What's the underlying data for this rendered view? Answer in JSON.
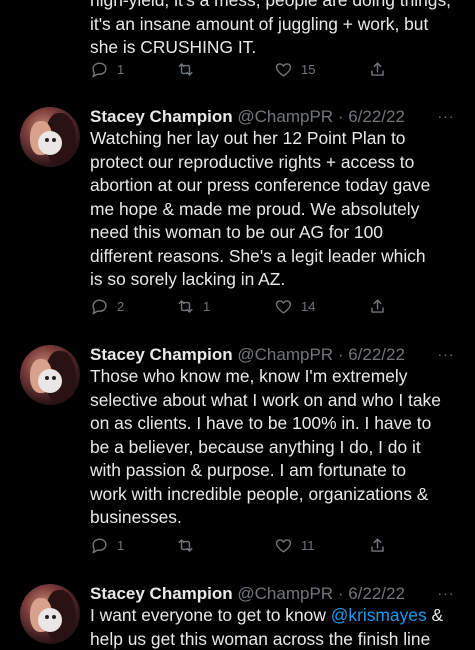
{
  "tweets": [
    {
      "text_lines": [
        "high-yield, it's a mess, people are doing things,",
        "it's an insane amount of juggling + work, but",
        "she is CRUSHING IT."
      ],
      "replies": "1",
      "retweets": "",
      "likes": "15"
    },
    {
      "name": "Stacey Champion",
      "handle": "@ChampPR",
      "separator": "·",
      "date": "6/22/22",
      "more": "···",
      "text_lines": [
        "Watching her lay out her 12 Point Plan to",
        "protect our reproductive rights + access to",
        "abortion at our press conference today gave",
        "me hope & made me proud. We absolutely",
        "need this woman to be our AG for 100",
        "different reasons. She's a legit leader which",
        "is so sorely lacking in AZ."
      ],
      "replies": "2",
      "retweets": "1",
      "likes": "14"
    },
    {
      "name": "Stacey Champion",
      "handle": "@ChampPR",
      "separator": "·",
      "date": "6/22/22",
      "more": "···",
      "text_lines": [
        "Those who know me, know I'm extremely",
        "selective about what I work on and who I take",
        "on as clients. I have to be 100% in. I have to",
        "be a believer, because anything I do, I do it",
        "with passion & purpose. I am fortunate to",
        "work with incredible people, organizations &",
        "businesses."
      ],
      "replies": "1",
      "retweets": "",
      "likes": "11"
    },
    {
      "name": "Stacey Champion",
      "handle": "@ChampPR",
      "separator": "·",
      "date": "6/22/22",
      "more": "···",
      "text_before_mention": "I want everyone to get to know ",
      "mention": "@krismayes",
      "text_after_mention": " &",
      "text_line_2": "help us get this woman across the finish line"
    }
  ],
  "icons": {
    "reply": "reply-icon",
    "retweet": "retweet-icon",
    "like": "heart-icon",
    "share": "share-icon",
    "more": "more-icon"
  },
  "colors": {
    "background": "#000000",
    "text": "#e7e9ea",
    "muted": "#71767b",
    "link": "#1d9bf0"
  }
}
